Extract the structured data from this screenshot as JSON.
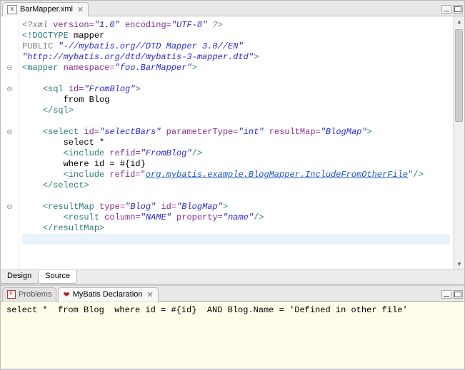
{
  "editor": {
    "tab_title": "BarMapper.xml",
    "icon_label": "X",
    "bottom_tabs": {
      "design": "Design",
      "source": "Source"
    },
    "code": {
      "l1": {
        "a": "<?xml",
        "b": " version=",
        "c": "\"1.0\"",
        "d": " encoding=",
        "e": "\"UTF-8\"",
        "f": " ?>"
      },
      "l2": {
        "a": "<!DOCTYPE",
        "b": " mapper"
      },
      "l3": {
        "a": "PUBLIC",
        "b": " \"-//mybatis.org//DTD Mapper 3.0//EN\""
      },
      "l4": "\"http://mybatis.org/dtd/mybatis-3-mapper.dtd\"",
      "l4b": ">",
      "l5": {
        "a": "<mapper",
        "b": " namespace=",
        "c": "\"foo.BarMapper\"",
        "d": ">"
      },
      "l7": {
        "a": "<sql",
        "b": " id=",
        "c": "\"FromBlog\"",
        "d": ">"
      },
      "l8": "from Blog",
      "l9": "</sql>",
      "l11": {
        "a": "<select",
        "b": " id=",
        "c": "\"selectBars\"",
        "d": " parameterType=",
        "e": "\"int\"",
        "f": " resultMap=",
        "g": "\"BlogMap\"",
        "h": ">"
      },
      "l12": "select *",
      "l13": {
        "a": "<include",
        "b": " refid=",
        "c": "\"FromBlog\"",
        "d": "/>"
      },
      "l14": "where id = #{id}",
      "l15": {
        "a": "<include",
        "b": " refid=\"",
        "c": "org.mybatis.example.BlogMapper.IncludeFromOtherFile",
        "d": "\"/>"
      },
      "l16": "</select>",
      "l18": {
        "a": "<resultMap",
        "b": " type=",
        "c": "\"Blog\"",
        "d": " id=",
        "e": "\"BlogMap\"",
        "f": ">"
      },
      "l19": {
        "a": "<result",
        "b": " column=",
        "c": "\"NAME\"",
        "d": " property=",
        "e": "\"name\"",
        "f": "/>"
      },
      "l20": "</resultMap>"
    }
  },
  "lower": {
    "tab_problems": "Problems",
    "tab_mybatis": "MyBatis Declaration",
    "sql_text": "select *  from Blog  where id = #{id}  AND Blog.Name = 'Defined in other file'"
  }
}
